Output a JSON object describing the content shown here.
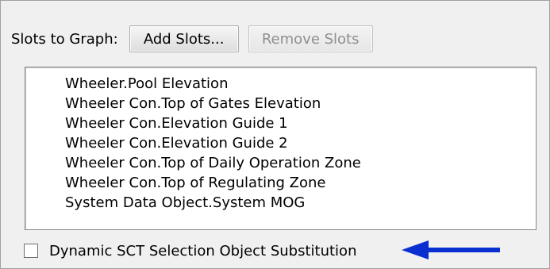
{
  "slots_panel": {
    "label": "Slots to Graph:",
    "add_button": "Add Slots...",
    "remove_button": "Remove Slots",
    "remove_enabled": false,
    "items": [
      "Wheeler.Pool Elevation",
      "Wheeler Con.Top of Gates Elevation",
      "Wheeler Con.Elevation Guide 1",
      "Wheeler Con.Elevation Guide 2",
      "Wheeler Con.Top of Daily Operation Zone",
      "Wheeler Con.Top of Regulating Zone",
      "System Data Object.System MOG"
    ]
  },
  "dynamic_checkbox": {
    "label": "Dynamic SCT Selection Object Substitution",
    "checked": false
  },
  "annotation": {
    "arrow_icon": "left-arrow-icon",
    "arrow_color": "#0a2fd0"
  },
  "colors": {
    "panel_background": "#f0f0f0",
    "list_background": "#ffffff",
    "disabled_text": "#8f8f8f"
  }
}
